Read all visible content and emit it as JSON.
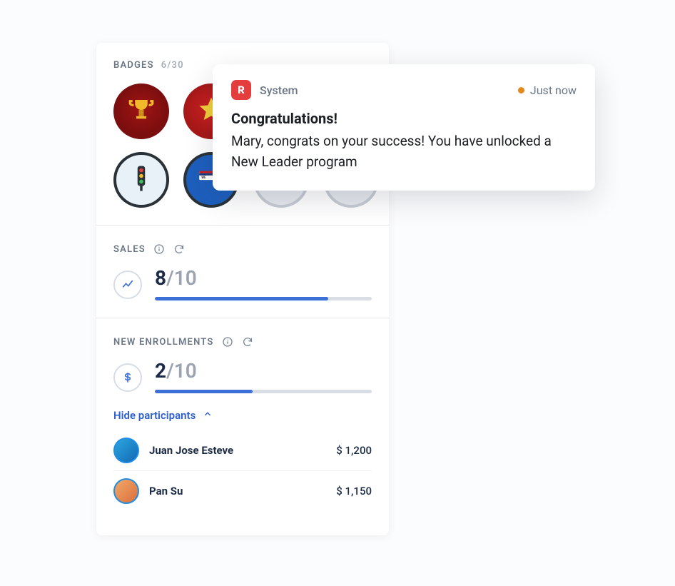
{
  "badges": {
    "title": "BADGES",
    "count": "6/30",
    "items": [
      {
        "name": "trophy",
        "locked": false
      },
      {
        "name": "star",
        "locked": false
      },
      {
        "name": "locked",
        "locked": true
      },
      {
        "name": "locked",
        "locked": true
      },
      {
        "name": "traffic-light",
        "locked": false
      },
      {
        "name": "sign",
        "locked": false
      },
      {
        "name": "locked",
        "locked": true
      },
      {
        "name": "locked",
        "locked": true
      }
    ]
  },
  "sales": {
    "title": "SALES",
    "value": "8",
    "denom": "/10",
    "progress_pct": 80
  },
  "enrollments": {
    "title": "NEW ENROLLMENTS",
    "value": "2",
    "denom": "/10",
    "progress_pct": 45,
    "toggle_label": "Hide participants",
    "participants": [
      {
        "name": "Juan Jose Esteve",
        "amount": "$ 1,200"
      },
      {
        "name": "Pan Su",
        "amount": "$ 1,150"
      }
    ]
  },
  "toast": {
    "app": "System",
    "app_initial": "R",
    "time": "Just now",
    "title": "Congratulations!",
    "message": "Mary, congrats on your success! You have unlocked a New Leader program"
  }
}
